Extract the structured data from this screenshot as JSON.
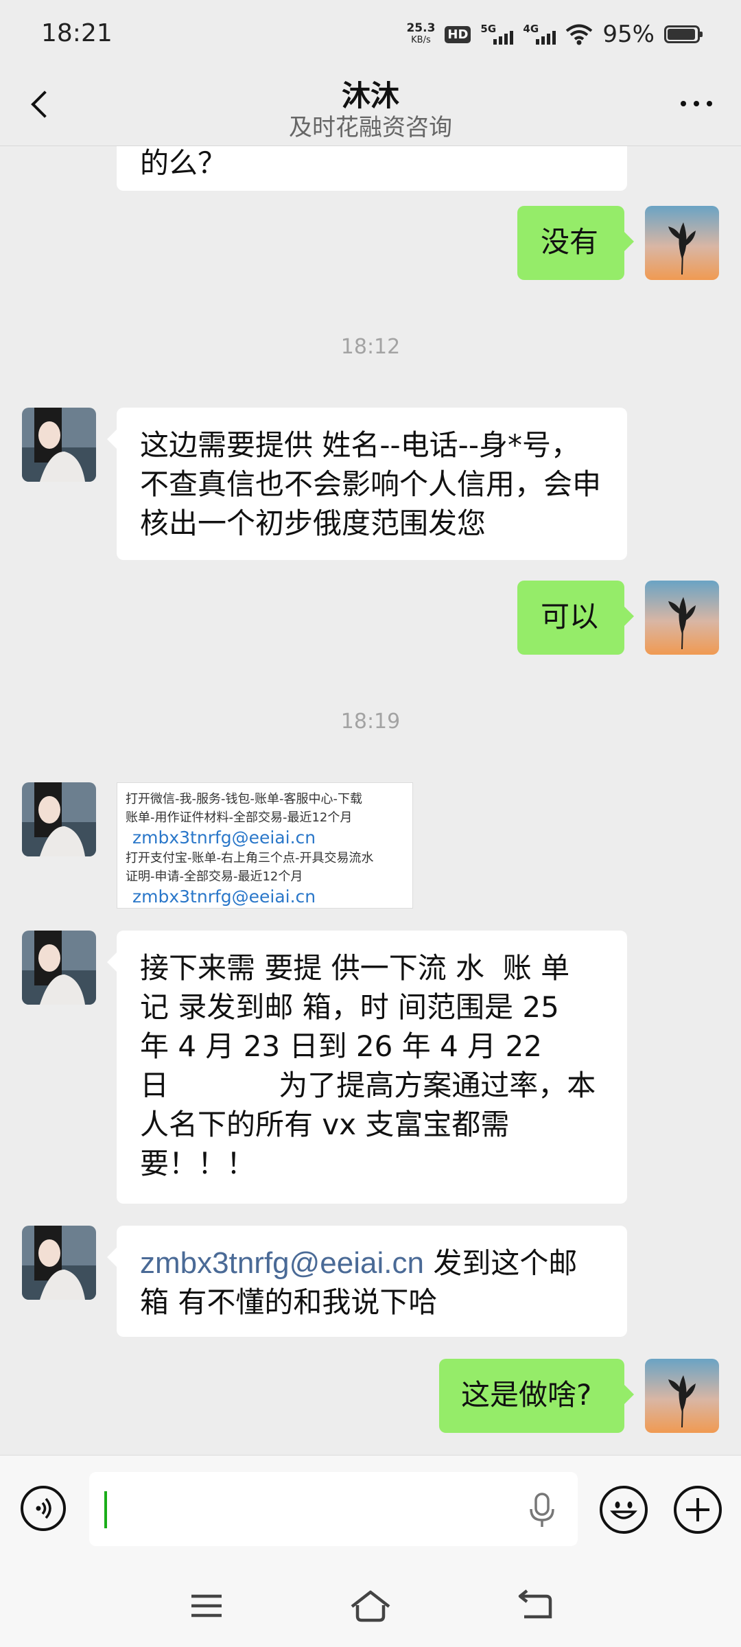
{
  "status_bar": {
    "time": "18:21",
    "net_speed": "25.3",
    "net_speed_unit": "KB/s",
    "hd": "HD",
    "net1": "5G",
    "net2": "4G",
    "battery": "95%",
    "battery_level": 0.95
  },
  "header": {
    "title": "沐沐",
    "subtitle": "及时花融资咨询"
  },
  "messages": {
    "m0_text": "的么？",
    "m1_text": "没有",
    "ts1": "18:12",
    "m2_text": "这边需要提供 姓名--电话--身*号，不查真信也不会影响个人信用，会申核出一个初步俄度范围发您",
    "m3_text": "可以",
    "ts2": "18:19",
    "card": {
      "line1": "打开微信-我-服务-钱包-账单-客服中心-下载",
      "line2": "账单-用作证件材料-全部交易-最近12个月",
      "email1": "zmbx3tnrfg@eeiai.cn",
      "line3": "打开支付宝-账单-右上角三个点-开具交易流水",
      "line4": "证明-申请-全部交易-最近12个月",
      "email2": "zmbx3tnrfg@eeiai.cn"
    },
    "m5_line1": "接下来需 要提 供一下流 水  账 单",
    "m5_line2": "记 录发到邮 箱，时 间范围是 25",
    "m5_line3": "年 4 月 23 日到 26 年 4 月 22",
    "m5_line4": "日            为了提高方案通过率，本",
    "m5_line5": "人名下的所有 vx 支富宝都需",
    "m5_line6": "要！！！",
    "m6_email": "zmbx3tnrfg@eeiai.cn",
    "m6_rest1": " 发到这个邮",
    "m6_rest2": "箱 有不懂的和我说下哈",
    "m7_text": "这是做啥?"
  },
  "input": {
    "value": "",
    "placeholder": ""
  },
  "icons": {
    "voice": "voice-icon",
    "mic": "microphone-icon",
    "emoji": "emoji-icon",
    "plus": "plus-icon",
    "menu": "menu-icon",
    "home": "home-icon",
    "back": "back-nav-icon"
  },
  "colors": {
    "background": "#ededed",
    "outgoing_bubble": "#95ec69",
    "incoming_bubble": "#ffffff",
    "link": "#4a6a96",
    "caret": "#1aad19"
  }
}
